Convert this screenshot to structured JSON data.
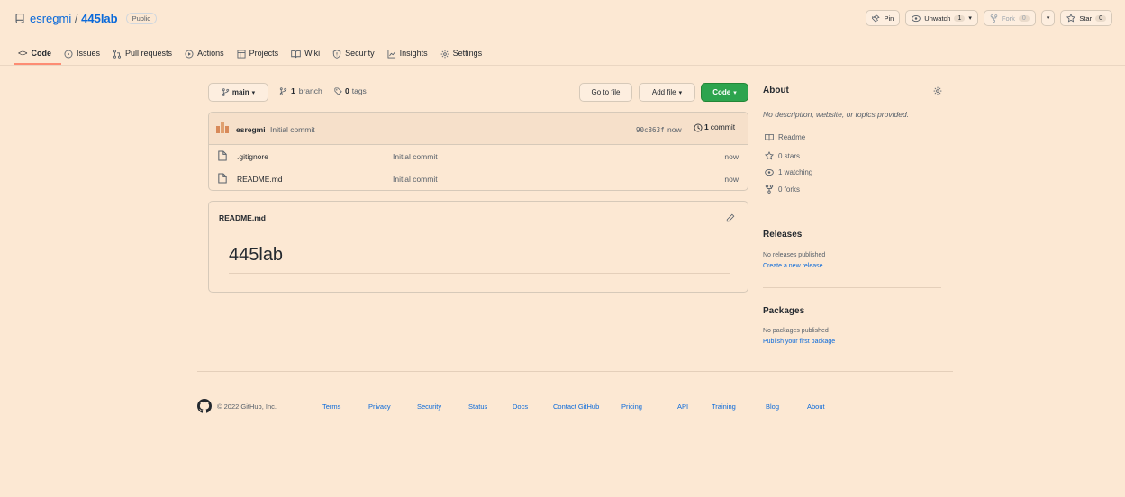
{
  "repo": {
    "owner": "esregmi",
    "separator": "/",
    "name": "445lab",
    "visibility": "Public"
  },
  "header_actions": {
    "pin": "Pin",
    "unwatch": "Unwatch",
    "watch_count": "1",
    "fork": "Fork",
    "fork_count": "0",
    "star": "Star",
    "star_count": "0"
  },
  "nav": [
    {
      "label": "Code",
      "icon": "code-icon",
      "active": true
    },
    {
      "label": "Issues",
      "icon": "issue-icon"
    },
    {
      "label": "Pull requests",
      "icon": "pull-request-icon"
    },
    {
      "label": "Actions",
      "icon": "play-icon"
    },
    {
      "label": "Projects",
      "icon": "table-icon"
    },
    {
      "label": "Wiki",
      "icon": "book-icon"
    },
    {
      "label": "Security",
      "icon": "shield-icon"
    },
    {
      "label": "Insights",
      "icon": "graph-icon"
    },
    {
      "label": "Settings",
      "icon": "gear-icon"
    }
  ],
  "toolbar": {
    "branch": "main",
    "branch_count": "1",
    "branch_label": "branch",
    "tag_count": "0",
    "tag_label": "tags",
    "go_to_file": "Go to file",
    "add_file": "Add file",
    "code": "Code"
  },
  "commit": {
    "author": "esregmi",
    "message": "Initial commit",
    "hash": "90c863f",
    "time": "now",
    "count": "1",
    "count_label": "commit"
  },
  "files": [
    {
      "name": ".gitignore",
      "message": "Initial commit",
      "time": "now"
    },
    {
      "name": "README.md",
      "message": "Initial commit",
      "time": "now"
    }
  ],
  "readme": {
    "filename": "README.md",
    "heading": "445lab"
  },
  "about": {
    "title": "About",
    "description": "No description, website, or topics provided.",
    "readme": "Readme",
    "stars": "0 stars",
    "watching": "1 watching",
    "forks": "0 forks"
  },
  "releases": {
    "title": "Releases",
    "none": "No releases published",
    "create": "Create a new release"
  },
  "packages": {
    "title": "Packages",
    "none": "No packages published",
    "publish": "Publish your first package"
  },
  "footer": {
    "copyright": "© 2022 GitHub, Inc.",
    "links": [
      "Terms",
      "Privacy",
      "Security",
      "Status",
      "Docs",
      "Contact GitHub",
      "Pricing",
      "API",
      "Training",
      "Blog",
      "About"
    ]
  },
  "colors": {
    "background": "#fce8d3",
    "link": "#0969da",
    "primary_button": "#2da44e",
    "tab_underline": "#fd8c73"
  }
}
